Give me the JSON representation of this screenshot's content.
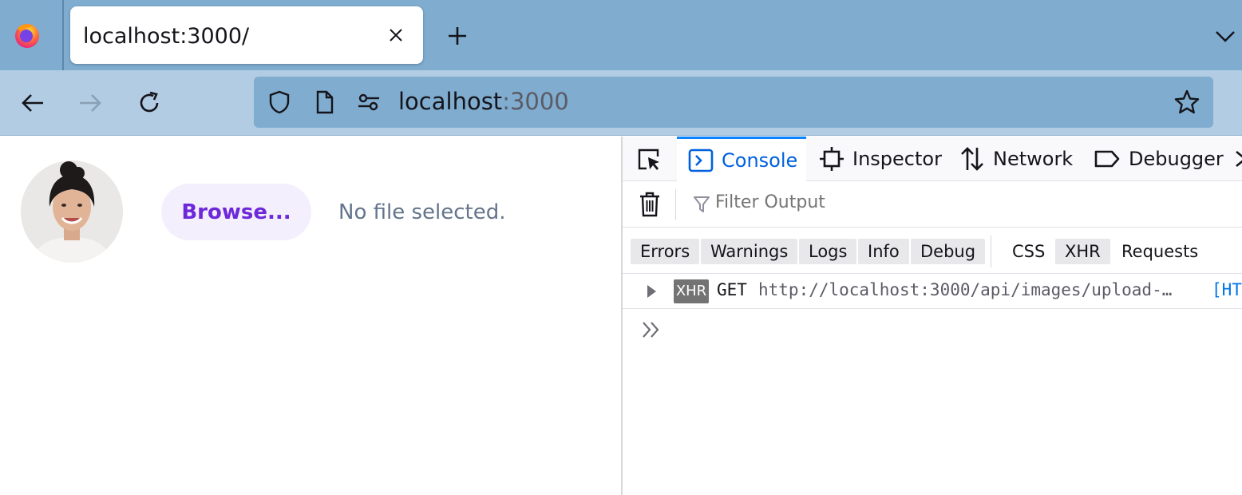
{
  "browser": {
    "tab": {
      "title": "localhost:3000/"
    },
    "urlbar": {
      "host": "localhost",
      "port": ":3000"
    }
  },
  "page": {
    "browse_label": "Browse...",
    "file_status": "No file selected."
  },
  "devtools": {
    "tabs": [
      {
        "label": "Console",
        "active": true,
        "icon": "console-icon"
      },
      {
        "label": "Inspector",
        "active": false,
        "icon": "inspector-icon"
      },
      {
        "label": "Network",
        "active": false,
        "icon": "network-icon"
      },
      {
        "label": "Debugger",
        "active": false,
        "icon": "debugger-icon"
      }
    ],
    "filter_placeholder": "Filter Output",
    "levels": [
      {
        "label": "Errors",
        "on": true
      },
      {
        "label": "Warnings",
        "on": true
      },
      {
        "label": "Logs",
        "on": true
      },
      {
        "label": "Info",
        "on": true
      },
      {
        "label": "Debug",
        "on": true
      }
    ],
    "extra_filters": [
      {
        "label": "CSS",
        "on": false
      },
      {
        "label": "XHR",
        "on": true
      },
      {
        "label": "Requests",
        "on": false
      }
    ],
    "messages": [
      {
        "badge": "XHR",
        "method": "GET",
        "url": "http://localhost:3000/api/images/upload-…",
        "status": "[HTTP"
      }
    ]
  },
  "colors": {
    "tabstrip": "#7faccf",
    "navbar": "#b1cce3",
    "devtools_accent": "#0061e0",
    "browse_text": "#6d28d9"
  }
}
